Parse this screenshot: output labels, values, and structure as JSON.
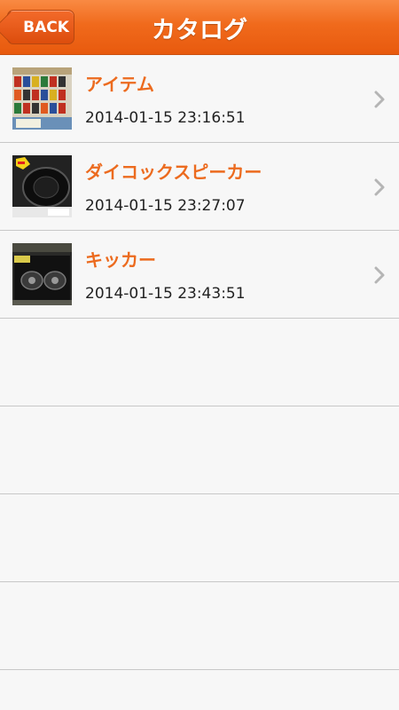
{
  "nav": {
    "back_label": "BACK",
    "title": "カタログ"
  },
  "items": [
    {
      "title": "アイテム",
      "date": "2014-01-15 23:16:51",
      "thumb": "store-shelf-image"
    },
    {
      "title": "ダイコックスピーカー",
      "date": "2014-01-15 23:27:07",
      "thumb": "speaker-box-image"
    },
    {
      "title": "キッカー",
      "date": "2014-01-15 23:43:51",
      "thumb": "speaker-package-image"
    }
  ],
  "colors": {
    "accent": "#ec6b1f",
    "navbar": "#f06a1c"
  }
}
